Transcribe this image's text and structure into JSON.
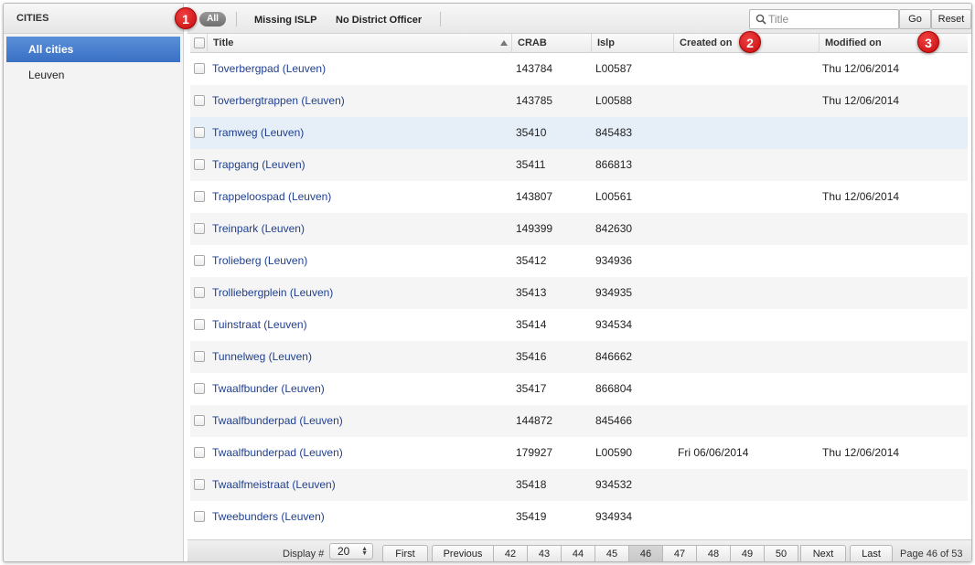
{
  "sidebar": {
    "header": "CITIES",
    "items": [
      {
        "label": "All cities",
        "active": true
      },
      {
        "label": "Leuven",
        "active": false
      }
    ]
  },
  "toolbar": {
    "filters": [
      "All",
      "Missing ISLP",
      "No District Officer"
    ],
    "search_placeholder": "Title",
    "go_label": "Go",
    "reset_label": "Reset"
  },
  "table": {
    "columns": [
      "Title",
      "CRAB",
      "Islp",
      "Created on",
      "Modified on"
    ],
    "sort": {
      "column": "Title",
      "direction": "ascending"
    },
    "rows": [
      {
        "title": "Toverbergpad (Leuven)",
        "crab": "143784",
        "islp": "L00587",
        "created": "",
        "modified": "Thu 12/06/2014"
      },
      {
        "title": "Toverbergtrappen (Leuven)",
        "crab": "143785",
        "islp": "L00588",
        "created": "",
        "modified": "Thu 12/06/2014"
      },
      {
        "title": "Tramweg (Leuven)",
        "crab": "35410",
        "islp": "845483",
        "created": "",
        "modified": ""
      },
      {
        "title": "Trapgang (Leuven)",
        "crab": "35411",
        "islp": "866813",
        "created": "",
        "modified": ""
      },
      {
        "title": "Trappeloospad (Leuven)",
        "crab": "143807",
        "islp": "L00561",
        "created": "",
        "modified": "Thu 12/06/2014"
      },
      {
        "title": "Treinpark (Leuven)",
        "crab": "149399",
        "islp": "842630",
        "created": "",
        "modified": ""
      },
      {
        "title": "Trolieberg (Leuven)",
        "crab": "35412",
        "islp": "934936",
        "created": "",
        "modified": ""
      },
      {
        "title": "Trolliebergplein (Leuven)",
        "crab": "35413",
        "islp": "934935",
        "created": "",
        "modified": ""
      },
      {
        "title": "Tuinstraat (Leuven)",
        "crab": "35414",
        "islp": "934534",
        "created": "",
        "modified": ""
      },
      {
        "title": "Tunnelweg (Leuven)",
        "crab": "35416",
        "islp": "846662",
        "created": "",
        "modified": ""
      },
      {
        "title": "Twaalfbunder (Leuven)",
        "crab": "35417",
        "islp": "866804",
        "created": "",
        "modified": ""
      },
      {
        "title": "Twaalfbunderpad (Leuven)",
        "crab": "144872",
        "islp": "845466",
        "created": "",
        "modified": ""
      },
      {
        "title": "Twaalfbunderpad (Leuven)",
        "crab": "179927",
        "islp": "L00590",
        "created": "Fri 06/06/2014",
        "modified": "Thu 12/06/2014"
      },
      {
        "title": "Twaalfmeistraat (Leuven)",
        "crab": "35418",
        "islp": "934532",
        "created": "",
        "modified": ""
      },
      {
        "title": "Tweebunders (Leuven)",
        "crab": "35419",
        "islp": "934934",
        "created": "",
        "modified": ""
      }
    ]
  },
  "pager": {
    "display_label": "Display #",
    "display_value": "20",
    "first": "First",
    "previous": "Previous",
    "pages": [
      "42",
      "43",
      "44",
      "45",
      "46",
      "47",
      "48",
      "49",
      "50"
    ],
    "current_page": "46",
    "next": "Next",
    "last": "Last",
    "page_info": "Page 46 of 53"
  },
  "callouts": [
    "1",
    "2",
    "3"
  ],
  "colors": {
    "accent": "#3a70c4",
    "link": "#1f3f8f",
    "callout": "#d81616",
    "row_highlight": "#e6eef7"
  },
  "icons": {
    "search": "search-icon",
    "checkbox": "checkbox-icon",
    "sort": "sort-ascending-icon"
  }
}
